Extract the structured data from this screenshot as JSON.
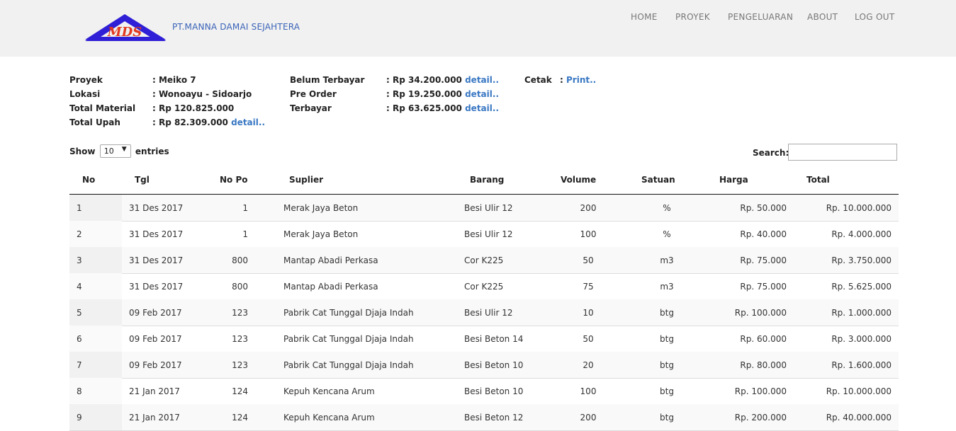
{
  "header": {
    "logo_text": "MDS",
    "company": "PT.MANNA DAMAI SEJAHTERA",
    "nav": [
      "HOME",
      "PROYEK",
      "PENGELUARAN",
      "ABOUT",
      "LOG OUT"
    ]
  },
  "info": {
    "proyek_label": "Proyek",
    "proyek_value": ": Meiko 7",
    "lokasi_label": "Lokasi",
    "lokasi_value": ": Wonoayu - Sidoarjo",
    "material_label": "Total Material",
    "material_value": ": Rp 120.825.000",
    "upah_label": "Total Upah",
    "upah_value": ": Rp 82.309.000",
    "belum_label": "Belum Terbayar",
    "belum_value": ": Rp 34.200.000",
    "preorder_label": "Pre Order",
    "preorder_value": ": Rp 19.250.000",
    "terbayar_label": "Terbayar",
    "terbayar_value": ": Rp 63.625.000",
    "cetak_label": "Cetak",
    "cetak_value": ":",
    "print_link": "Print..",
    "detail_link": "detail.."
  },
  "controls": {
    "show_label": "Show",
    "entries_value": "10",
    "entries_label": "entries",
    "search_label": "Search:"
  },
  "table": {
    "headers": [
      "No",
      "Tgl",
      "No Po",
      "Suplier",
      "Barang",
      "Volume",
      "Satuan",
      "Harga",
      "Total"
    ],
    "rows": [
      [
        "1",
        "31 Des 2017",
        "1",
        "Merak Jaya Beton",
        "Besi Ulir 12",
        "200",
        "%",
        "Rp. 50.000",
        "Rp. 10.000.000"
      ],
      [
        "2",
        "31 Des 2017",
        "1",
        "Merak Jaya Beton",
        "Besi Ulir 12",
        "100",
        "%",
        "Rp. 40.000",
        "Rp. 4.000.000"
      ],
      [
        "3",
        "31 Des 2017",
        "800",
        "Mantap Abadi Perkasa",
        "Cor K225",
        "50",
        "m3",
        "Rp. 75.000",
        "Rp. 3.750.000"
      ],
      [
        "4",
        "31 Des 2017",
        "800",
        "Mantap Abadi Perkasa",
        "Cor K225",
        "75",
        "m3",
        "Rp. 75.000",
        "Rp. 5.625.000"
      ],
      [
        "5",
        "09 Feb 2017",
        "123",
        "Pabrik Cat Tunggal Djaja Indah",
        "Besi Ulir 12",
        "10",
        "btg",
        "Rp. 100.000",
        "Rp. 1.000.000"
      ],
      [
        "6",
        "09 Feb 2017",
        "123",
        "Pabrik Cat Tunggal Djaja Indah",
        "Besi Beton 14",
        "50",
        "btg",
        "Rp. 60.000",
        "Rp. 3.000.000"
      ],
      [
        "7",
        "09 Feb 2017",
        "123",
        "Pabrik Cat Tunggal Djaja Indah",
        "Besi Beton 10",
        "20",
        "btg",
        "Rp. 80.000",
        "Rp. 1.600.000"
      ],
      [
        "8",
        "21 Jan 2017",
        "124",
        "Kepuh Kencana Arum",
        "Besi Beton 10",
        "100",
        "btg",
        "Rp. 100.000",
        "Rp. 10.000.000"
      ],
      [
        "9",
        "21 Jan 2017",
        "124",
        "Kepuh Kencana Arum",
        "Besi Beton 12",
        "200",
        "btg",
        "Rp. 200.000",
        "Rp. 40.000.000"
      ]
    ]
  }
}
